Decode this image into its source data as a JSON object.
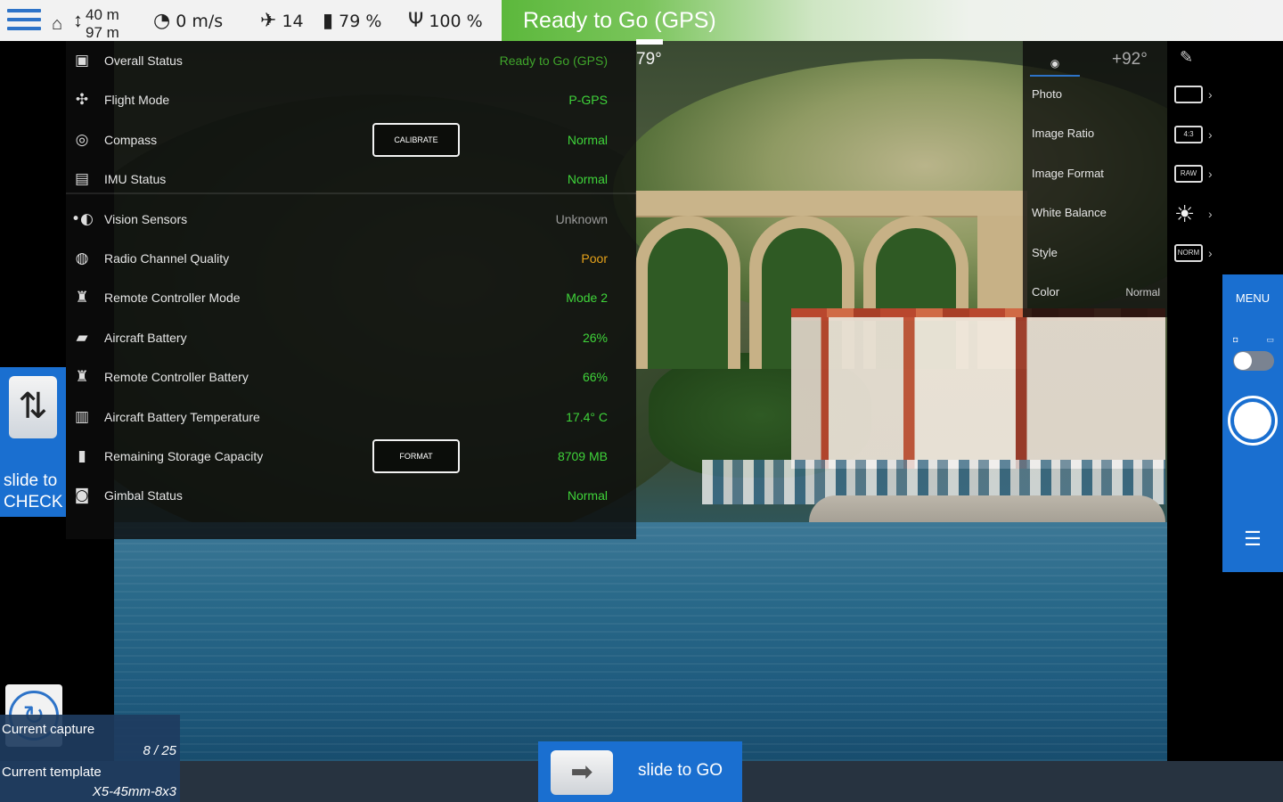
{
  "topbar": {
    "altitude_home": "40 m",
    "altitude_ground": "97 m",
    "speed": "0 m/s",
    "satellites": "14",
    "battery": "79 %",
    "signal": "100 %",
    "ready_banner": "Ready to Go (GPS)",
    "colors": {
      "banner_green": "#5cb83c",
      "menu_blue": "#2d73c8"
    }
  },
  "heading": "79°",
  "status_panel": {
    "rows": [
      {
        "icon": "overall-status-icon",
        "label": "Overall Status",
        "value": "Ready to Go (GPS)",
        "color": "#3fa52b"
      },
      {
        "icon": "flight-mode-icon",
        "label": "Flight Mode",
        "value": "P-GPS",
        "color": "#3fd43a"
      },
      {
        "icon": "compass-icon",
        "label": "Compass",
        "value": "Normal",
        "color": "#3fd43a",
        "button": "CALIBRATE"
      },
      {
        "icon": "imu-icon",
        "label": "IMU Status",
        "value": "Normal",
        "color": "#3fd43a"
      },
      {
        "icon": "vision-sensor-icon",
        "label": "Vision Sensors",
        "value": "Unknown",
        "color": "#9a9a9a"
      },
      {
        "icon": "radio-channel-icon",
        "label": "Radio Channel Quality",
        "value": "Poor",
        "color": "#e6a21a"
      },
      {
        "icon": "remote-controller-icon",
        "label": "Remote Controller Mode",
        "value": "Mode 2",
        "color": "#3fd43a"
      },
      {
        "icon": "aircraft-battery-icon",
        "label": "Aircraft Battery",
        "value": "26%",
        "color": "#3fd43a"
      },
      {
        "icon": "rc-battery-icon",
        "label": "Remote Controller Battery",
        "value": "66%",
        "color": "#3fd43a"
      },
      {
        "icon": "battery-temperature-icon",
        "label": "Aircraft Battery Temperature",
        "value": "17.4° C",
        "color": "#3fd43a"
      },
      {
        "icon": "storage-icon",
        "label": "Remaining Storage Capacity",
        "value": "8709 MB",
        "color": "#3fd43a",
        "button": "FORMAT"
      },
      {
        "icon": "gimbal-icon",
        "label": "Gimbal Status",
        "value": "Normal",
        "color": "#3fd43a"
      }
    ]
  },
  "camera_panel": {
    "ev": "+92°",
    "rows": [
      {
        "label": "Photo",
        "value": ""
      },
      {
        "label": "Image Ratio",
        "value": ""
      },
      {
        "label": "Image Format",
        "value": ""
      },
      {
        "label": "White Balance",
        "value": ""
      },
      {
        "label": "Style",
        "value": ""
      },
      {
        "label": "Color",
        "value": "Normal"
      }
    ],
    "icon_labels": {
      "ratio": "4:3",
      "format": "RAW",
      "style": "NORM"
    }
  },
  "right_column": {
    "menu_label": "MENU"
  },
  "left": {
    "slide_check_line1": "slide to",
    "slide_check_line2": "CHECK"
  },
  "capture": {
    "current_capture_label": "Current capture",
    "current_capture_value": "8 / 25",
    "current_template_label": "Current template",
    "current_template_value": "X5-45mm-8x3"
  },
  "slide_go_label": "slide to GO"
}
